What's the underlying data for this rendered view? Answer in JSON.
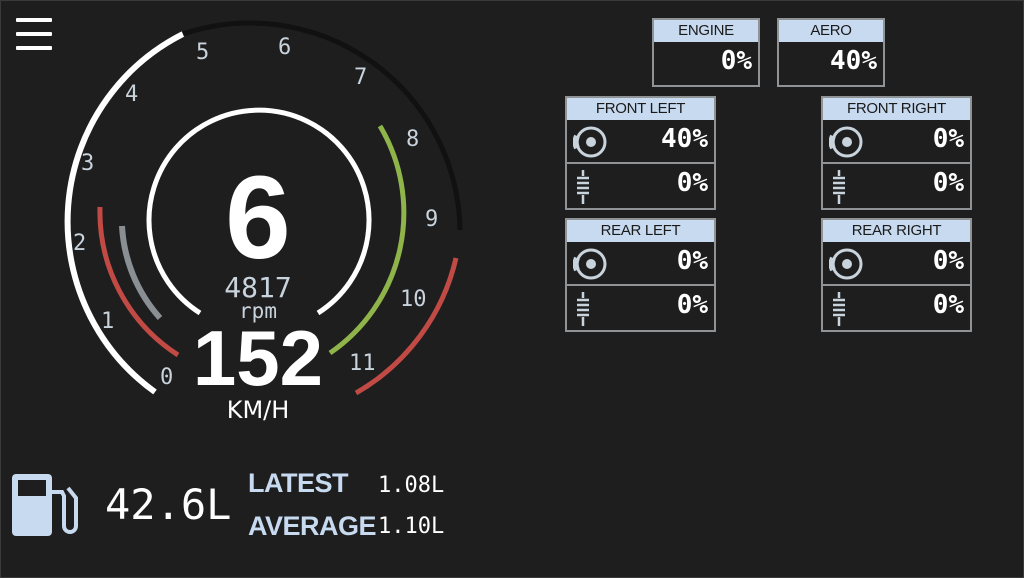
{
  "gauge": {
    "gear": "6",
    "rpm_value": "4817",
    "rpm_unit": "rpm",
    "speed": "152",
    "speed_unit": "KM/H",
    "scale_labels": [
      "0",
      "1",
      "2",
      "3",
      "4",
      "5",
      "6",
      "7",
      "8",
      "9",
      "10",
      "11"
    ],
    "rpm_fill_fraction": 0.44
  },
  "damage": {
    "engine": {
      "label": "ENGINE",
      "value": "0%"
    },
    "aero": {
      "label": "AERO",
      "value": "40%"
    },
    "front_left": {
      "label": "FRONT LEFT",
      "brake": "40%",
      "suspension": "0%"
    },
    "front_right": {
      "label": "FRONT RIGHT",
      "brake": "0%",
      "suspension": "0%"
    },
    "rear_left": {
      "label": "REAR LEFT",
      "brake": "0%",
      "suspension": "0%"
    },
    "rear_right": {
      "label": "REAR RIGHT",
      "brake": "0%",
      "suspension": "0%"
    }
  },
  "fuel": {
    "amount": "42.6L",
    "latest_label": "LATEST",
    "latest_value": "1.08L",
    "average_label": "AVERAGE",
    "average_value": "1.10L"
  },
  "colors": {
    "accent": "#c7daf0",
    "green": "#8fb54a",
    "red": "#c24a45",
    "gray": "#8f9396"
  },
  "icons": {
    "menu": "hamburger-menu-icon",
    "fuel": "fuel-pump-icon",
    "brake": "brake-disc-icon",
    "suspension": "suspension-spring-icon"
  }
}
